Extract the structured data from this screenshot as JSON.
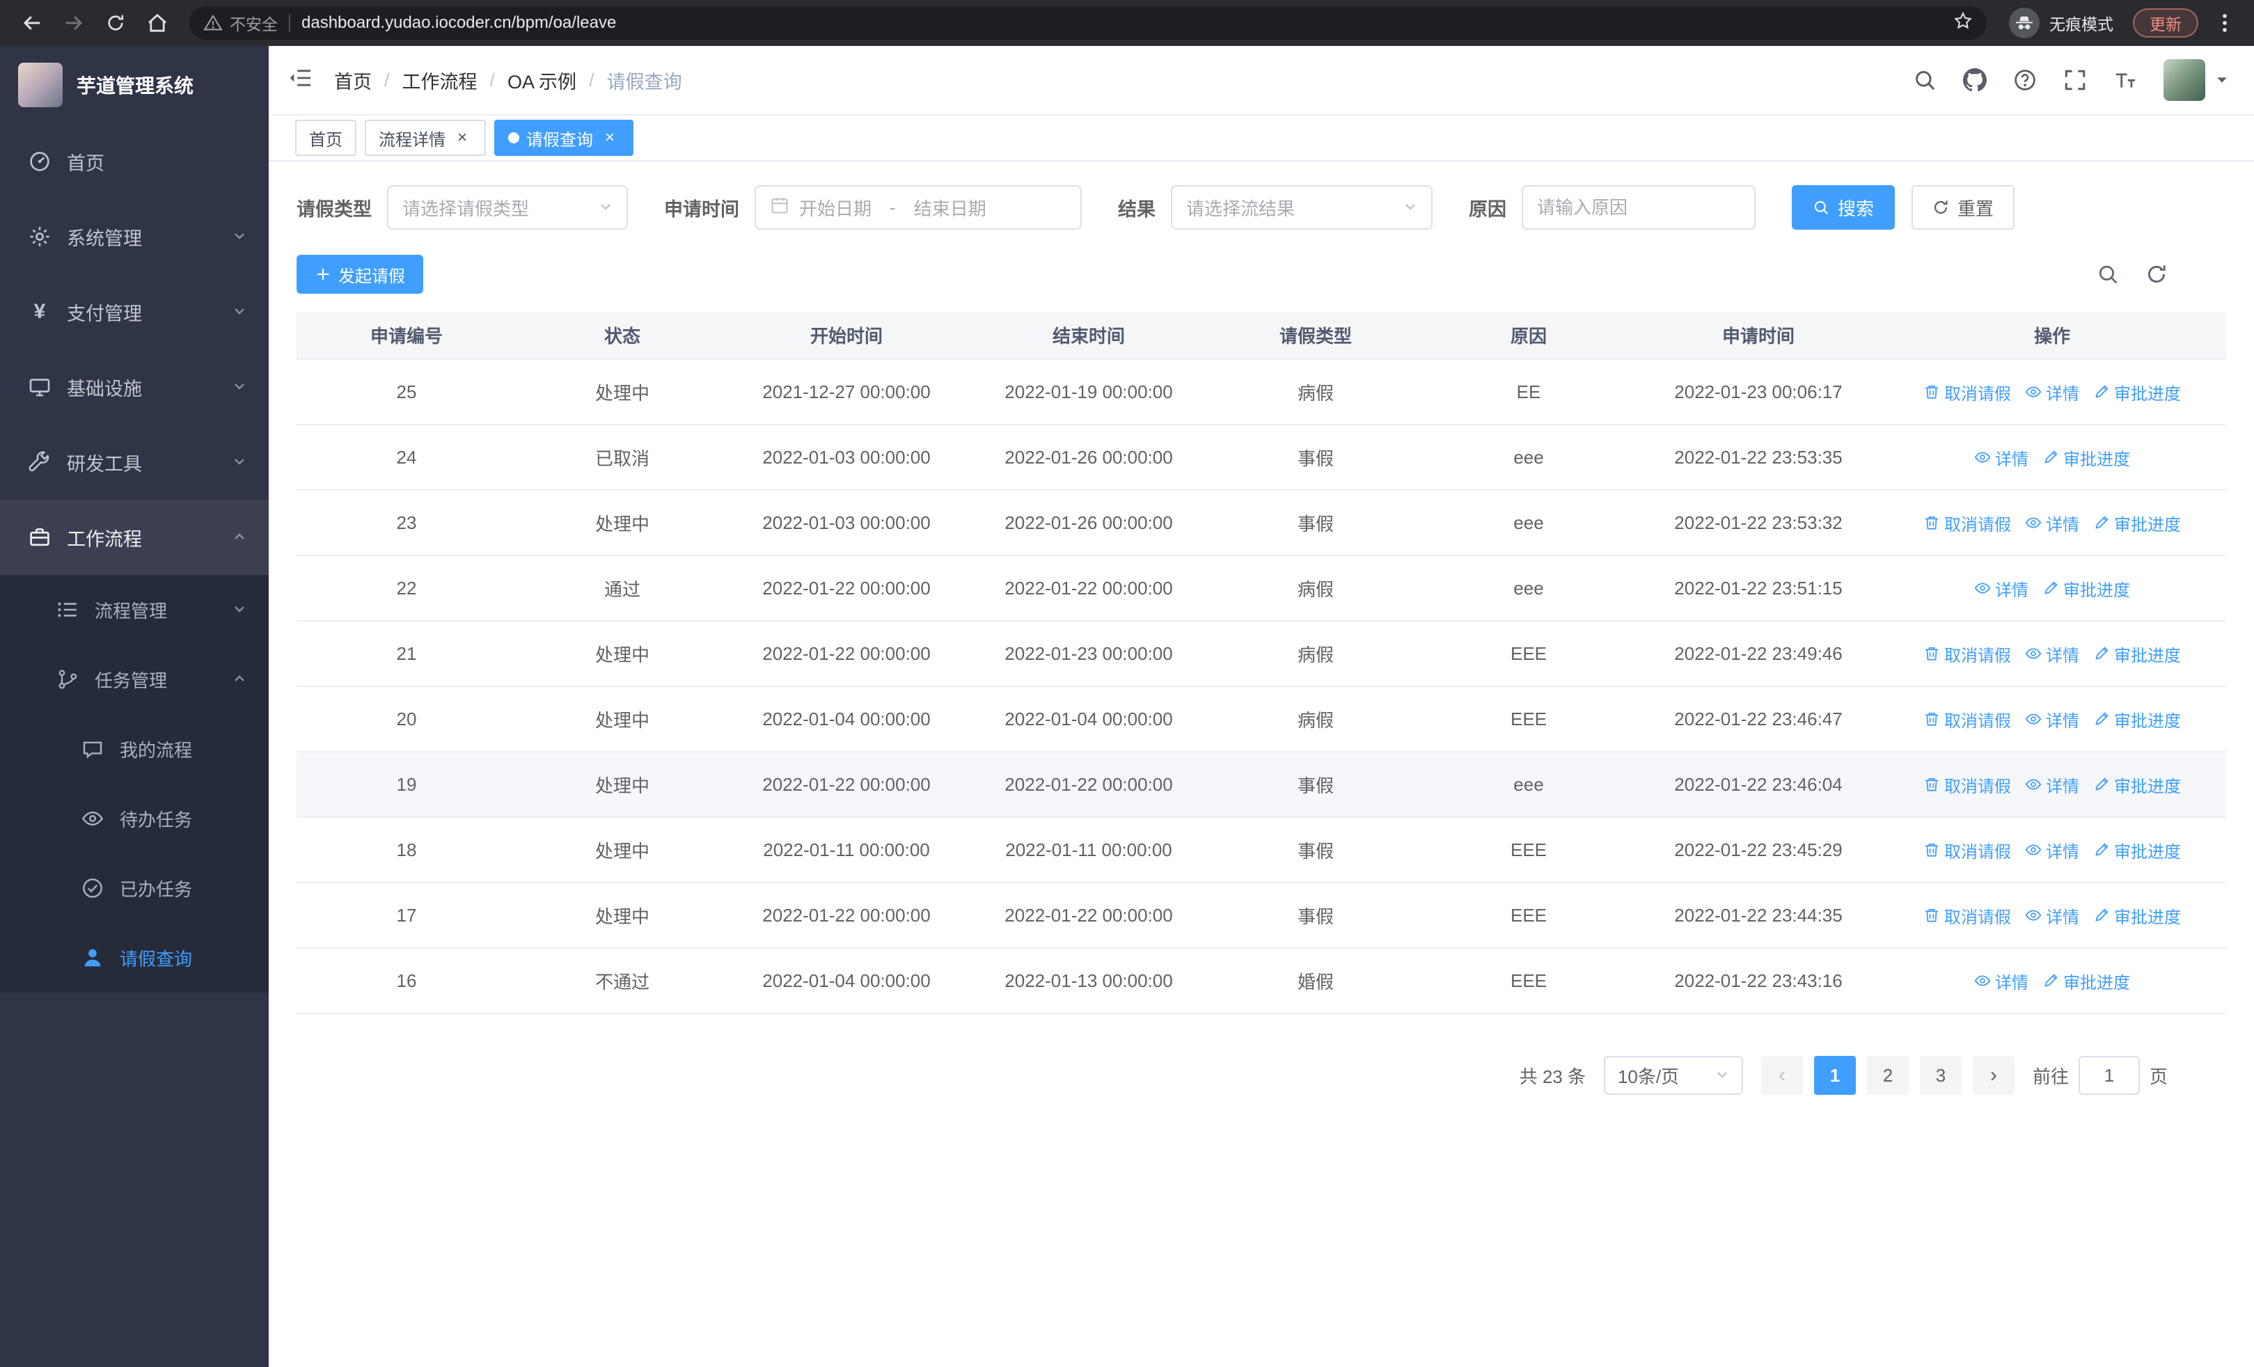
{
  "browser": {
    "security_label": "不安全",
    "url": "dashboard.yudao.iocoder.cn/bpm/oa/leave",
    "incognito_label": "无痕模式",
    "update_button": "更新"
  },
  "sidebar": {
    "title": "芋道管理系统",
    "home": "首页",
    "system_mgmt": "系统管理",
    "payment_mgmt": "支付管理",
    "infrastructure": "基础设施",
    "dev_tools": "研发工具",
    "workflow": "工作流程",
    "process_mgmt": "流程管理",
    "task_mgmt": "任务管理",
    "my_process": "我的流程",
    "todo_tasks": "待办任务",
    "done_tasks": "已办任务",
    "leave_query": "请假查询"
  },
  "header": {
    "breadcrumb": [
      "首页",
      "工作流程",
      "OA 示例",
      "请假查询"
    ],
    "breadcrumb_separator": "/"
  },
  "tabs": {
    "home": "首页",
    "process_detail": "流程详情",
    "leave_query": "请假查询"
  },
  "filters": {
    "leave_type_label": "请假类型",
    "leave_type_placeholder": "请选择请假类型",
    "apply_time_label": "申请时间",
    "start_date_placeholder": "开始日期",
    "date_separator": "-",
    "end_date_placeholder": "结束日期",
    "result_label": "结果",
    "result_placeholder": "请选择流结果",
    "reason_label": "原因",
    "reason_placeholder": "请输入原因",
    "search_button": "搜索",
    "reset_button": "重置"
  },
  "toolbar": {
    "create_button": "发起请假"
  },
  "table": {
    "columns": [
      "申请编号",
      "状态",
      "开始时间",
      "结束时间",
      "请假类型",
      "原因",
      "申请时间",
      "操作"
    ],
    "highlighted_id": "19",
    "action_labels": {
      "cancel": "取消请假",
      "detail": "详情",
      "progress": "审批进度"
    },
    "action_icons": {
      "cancel": "trash-icon",
      "detail": "eye-icon",
      "progress": "edit-icon"
    },
    "rows": [
      {
        "id": "25",
        "status": "处理中",
        "start": "2021-12-27 00:00:00",
        "end": "2022-01-19 00:00:00",
        "type": "病假",
        "reason": "EE",
        "applied": "2022-01-23 00:06:17",
        "actions": [
          "cancel",
          "detail",
          "progress"
        ]
      },
      {
        "id": "24",
        "status": "已取消",
        "start": "2022-01-03 00:00:00",
        "end": "2022-01-26 00:00:00",
        "type": "事假",
        "reason": "eee",
        "applied": "2022-01-22 23:53:35",
        "actions": [
          "detail",
          "progress"
        ]
      },
      {
        "id": "23",
        "status": "处理中",
        "start": "2022-01-03 00:00:00",
        "end": "2022-01-26 00:00:00",
        "type": "事假",
        "reason": "eee",
        "applied": "2022-01-22 23:53:32",
        "actions": [
          "cancel",
          "detail",
          "progress"
        ]
      },
      {
        "id": "22",
        "status": "通过",
        "start": "2022-01-22 00:00:00",
        "end": "2022-01-22 00:00:00",
        "type": "病假",
        "reason": "eee",
        "applied": "2022-01-22 23:51:15",
        "actions": [
          "detail",
          "progress"
        ]
      },
      {
        "id": "21",
        "status": "处理中",
        "start": "2022-01-22 00:00:00",
        "end": "2022-01-23 00:00:00",
        "type": "病假",
        "reason": "EEE",
        "applied": "2022-01-22 23:49:46",
        "actions": [
          "cancel",
          "detail",
          "progress"
        ]
      },
      {
        "id": "20",
        "status": "处理中",
        "start": "2022-01-04 00:00:00",
        "end": "2022-01-04 00:00:00",
        "type": "病假",
        "reason": "EEE",
        "applied": "2022-01-22 23:46:47",
        "actions": [
          "cancel",
          "detail",
          "progress"
        ]
      },
      {
        "id": "19",
        "status": "处理中",
        "start": "2022-01-22 00:00:00",
        "end": "2022-01-22 00:00:00",
        "type": "事假",
        "reason": "eee",
        "applied": "2022-01-22 23:46:04",
        "actions": [
          "cancel",
          "detail",
          "progress"
        ]
      },
      {
        "id": "18",
        "status": "处理中",
        "start": "2022-01-11 00:00:00",
        "end": "2022-01-11 00:00:00",
        "type": "事假",
        "reason": "EEE",
        "applied": "2022-01-22 23:45:29",
        "actions": [
          "cancel",
          "detail",
          "progress"
        ]
      },
      {
        "id": "17",
        "status": "处理中",
        "start": "2022-01-22 00:00:00",
        "end": "2022-01-22 00:00:00",
        "type": "事假",
        "reason": "EEE",
        "applied": "2022-01-22 23:44:35",
        "actions": [
          "cancel",
          "detail",
          "progress"
        ]
      },
      {
        "id": "16",
        "status": "不通过",
        "start": "2022-01-04 00:00:00",
        "end": "2022-01-13 00:00:00",
        "type": "婚假",
        "reason": "EEE",
        "applied": "2022-01-22 23:43:16",
        "actions": [
          "detail",
          "progress"
        ]
      }
    ]
  },
  "pagination": {
    "total_label": "共 23 条",
    "page_size_label": "10条/页",
    "pages": [
      "1",
      "2",
      "3"
    ],
    "active_page": "1",
    "goto_label": "前往",
    "goto_value": "1",
    "goto_suffix_label": "页"
  },
  "colors": {
    "primary": "#409eff",
    "sidebar_bg": "#2f3447",
    "submenu_bg": "#262b3a",
    "table_header_bg": "#f5f6f8",
    "update_badge_text": "#f28b82"
  }
}
